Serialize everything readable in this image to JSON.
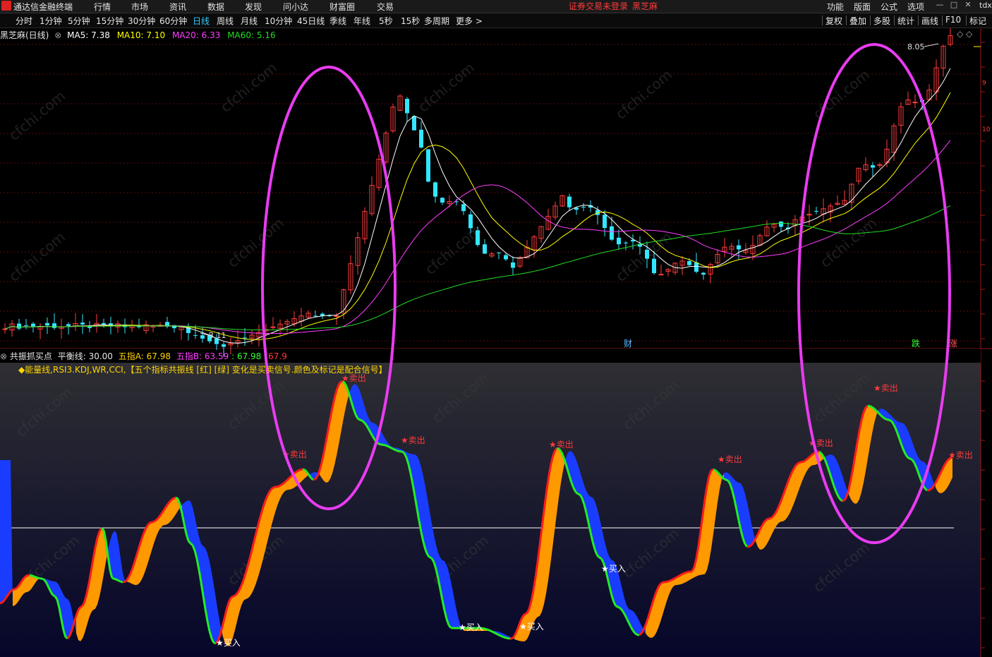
{
  "menubar": {
    "app_title": "通达信金融终端",
    "items": [
      "行情",
      "市场",
      "资讯",
      "数据",
      "发现",
      "问小达",
      "财富圈",
      "交易"
    ],
    "warning": "证券交易未登录",
    "stock_name": "黑芝麻",
    "right_items": [
      "功能",
      "版面",
      "公式",
      "选项"
    ],
    "tdx": "tdx"
  },
  "periodbar": {
    "periods": [
      "分时",
      "1分钟",
      "5分钟",
      "15分钟",
      "30分钟",
      "60分钟",
      "日线",
      "周线",
      "月线",
      "10分钟",
      "45日线",
      "季线",
      "年线",
      "5秒",
      "15秒",
      "多周期",
      "更多 >"
    ],
    "active": "日线",
    "right_buttons": [
      "复权",
      "叠加",
      "多股",
      "统计",
      "画线",
      "F10",
      "标记"
    ]
  },
  "main_panel": {
    "title": "黑芝麻(日线)",
    "ma": [
      {
        "label": "MA5: 7.38",
        "color": "#ffffff"
      },
      {
        "label": "MA10: 7.10",
        "color": "#ffff00"
      },
      {
        "label": "MA20: 6.33",
        "color": "#ff3cff"
      },
      {
        "label": "MA60: 5.16",
        "color": "#22dd22"
      }
    ],
    "high_label": "8.05",
    "low_label": "3.11",
    "markers": [
      {
        "text": "财",
        "color": "#5bb8ff"
      },
      {
        "text": "跌",
        "color": "#33ff33"
      },
      {
        "text": "涨",
        "color": "#ff5555"
      }
    ],
    "right_axis": [
      "9",
      "10"
    ],
    "watermark": "cfchi.com"
  },
  "indicator_panel": {
    "title": "共振抓买点",
    "balance_line": "平衡线: 30.00",
    "index_a": "五指A: 67.98",
    "index_b": "五指B: 63.59",
    "extra_1": ": 67.98",
    "extra_2": "67.9",
    "description": "◆能量线,RSI3.KDJ,WR,CCI,【五个指标共振线 [红] [绿] 变化是买卖信号.颜色及标记是配合信号】",
    "sell_label": "★卖出",
    "buy_label": "★买入"
  },
  "colors": {
    "up_candle": "#ff3b3b",
    "down_candle": "#33e6ff",
    "ellipse": "#e83cf0",
    "band_up": "#ff9900",
    "band_down": "#1a3cff",
    "line_red": "#ff1a1a",
    "line_green": "#22ee22"
  }
}
